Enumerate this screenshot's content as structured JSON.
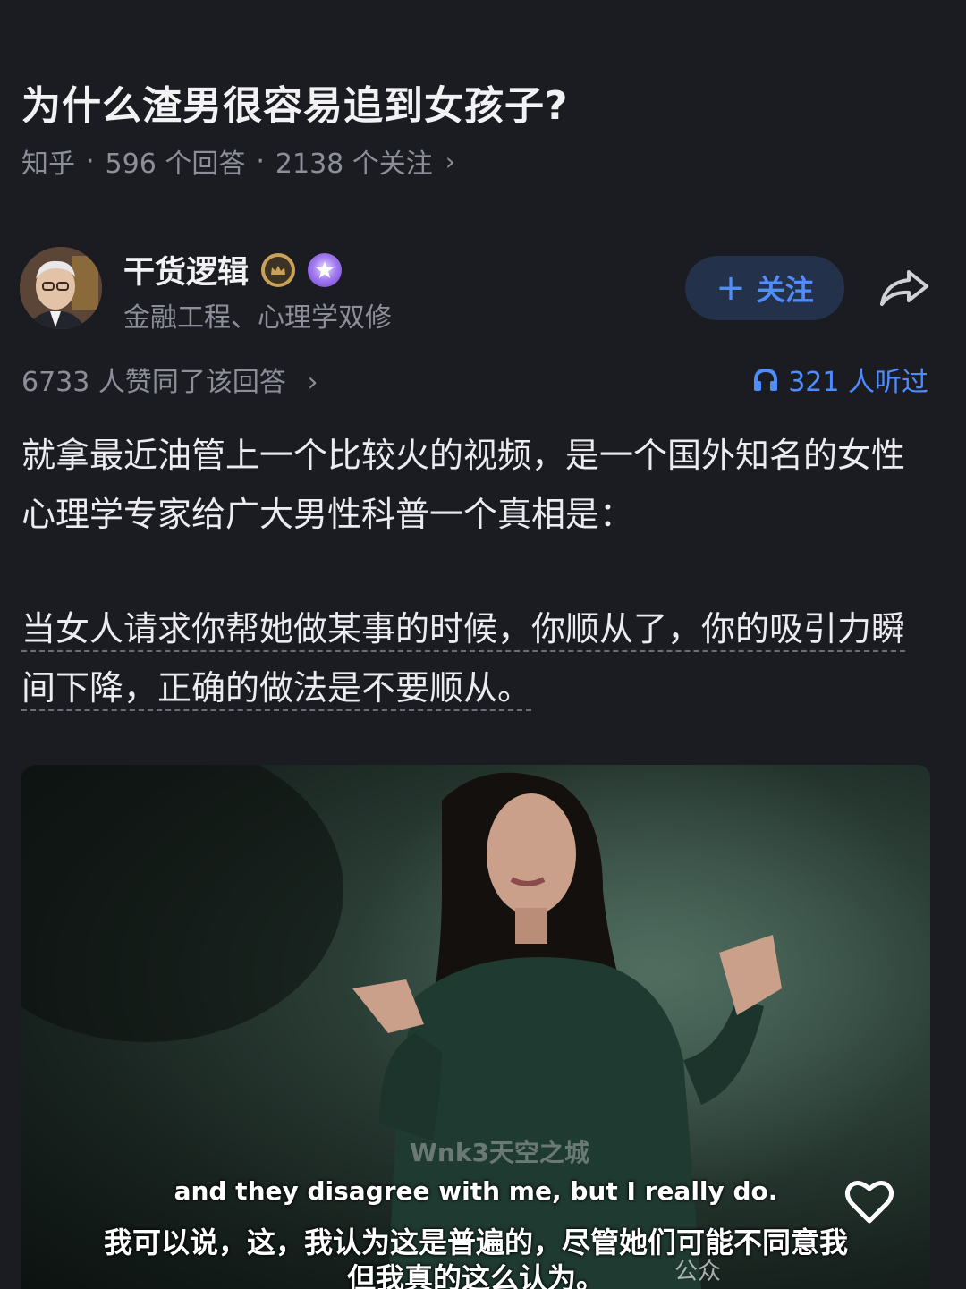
{
  "question": {
    "title": "为什么渣男很容易追到女孩子?",
    "source": "知乎",
    "answers": "596 个回答",
    "followers": "2138 个关注",
    "separator": "·"
  },
  "author": {
    "name": "干货逻辑",
    "bio": "金融工程、心理学双修",
    "follow_label": "关注",
    "badges": [
      "crown-badge-icon",
      "star-badge-icon"
    ]
  },
  "answer": {
    "agree_text": "6733 人赞同了该回答",
    "listen_text": "321 人听过",
    "paragraph_1": "就拿最近油管上一个比较火的视频，是一个国外知名的女性心理学专家给广大男性科普一个真相是：",
    "paragraph_2": "当女人请求你帮她做某事的时候，你顺从了，你的吸引力瞬间下降，正确的做法是不要顺从。"
  },
  "video": {
    "watermark": "Wnk3天空之城",
    "subtitle_en": "and they disagree with me, but I really do.",
    "subtitle_zh_1": "我可以说，这，我认为这是普遍的，尽管她们可能不同意我",
    "subtitle_zh_2": "但我真的这么认为。",
    "corner_mark": "公众"
  },
  "colors": {
    "background": "#1b1c21",
    "accent": "#4f8dff",
    "muted": "#8c8f99",
    "follow_bg": "#23324a"
  }
}
